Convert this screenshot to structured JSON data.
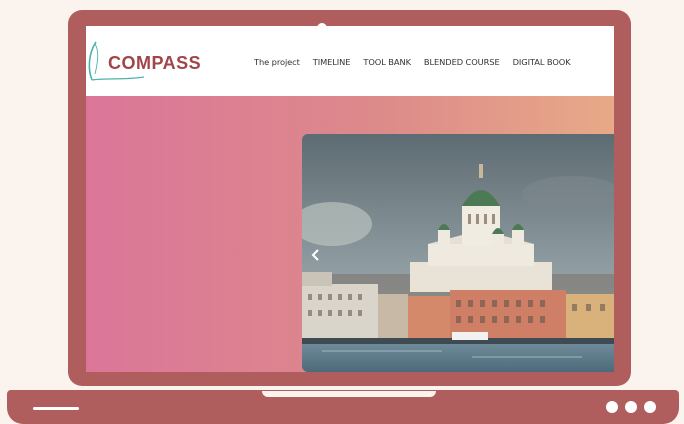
{
  "brand": {
    "name": "COMPASS"
  },
  "nav": {
    "items": [
      {
        "label": "The project"
      },
      {
        "label": "TIMELINE"
      },
      {
        "label": "TOOL BANK"
      },
      {
        "label": "BLENDED COURSE"
      },
      {
        "label": "DIGITAL BOOK"
      }
    ]
  },
  "slider": {
    "prev_icon": "chevron-left-icon",
    "image": "city-harbour-cathedral-photo"
  },
  "colors": {
    "frame": "#b05e5d",
    "background": "#fbf3ee",
    "gradient_start": "#db7699",
    "gradient_end": "#e7a987",
    "brand": "#a24549",
    "logo_swoosh": "#4fb3a8"
  }
}
